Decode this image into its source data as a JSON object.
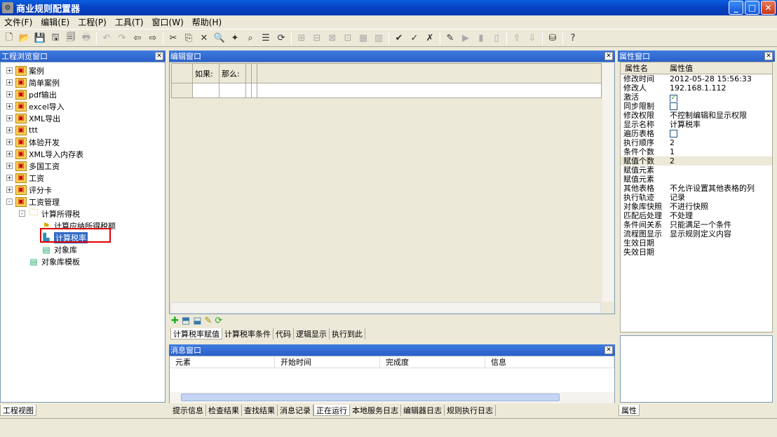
{
  "window": {
    "title": "商业规则配置器"
  },
  "menu": [
    "文件(F)",
    "编辑(E)",
    "工程(P)",
    "工具(T)",
    "窗口(W)",
    "帮助(H)"
  ],
  "toolbar_icons": [
    "new-file",
    "open-folder",
    "save",
    "disk",
    "save-all",
    "print",
    "undo",
    "redo",
    "back",
    "forward",
    "cut",
    "copy",
    "delete",
    "find",
    "wand",
    "binoculars",
    "properties",
    "refresh",
    "rule1",
    "rule2",
    "rule3",
    "rule4",
    "rule5",
    "rule6",
    "check1",
    "check2",
    "check3",
    "edit",
    "play",
    "chart1",
    "chart2",
    "export",
    "import",
    "db",
    "help"
  ],
  "project_panel": {
    "title": "工程浏览窗口",
    "items": [
      {
        "label": "案例",
        "level": 0,
        "toggle": "+",
        "icon": "proj"
      },
      {
        "label": "简单案例",
        "level": 0,
        "toggle": "+",
        "icon": "proj"
      },
      {
        "label": "pdf输出",
        "level": 0,
        "toggle": "+",
        "icon": "proj"
      },
      {
        "label": "excel导入",
        "level": 0,
        "toggle": "+",
        "icon": "proj"
      },
      {
        "label": "XML导出",
        "level": 0,
        "toggle": "+",
        "icon": "proj"
      },
      {
        "label": "ttt",
        "level": 0,
        "toggle": "+",
        "icon": "proj"
      },
      {
        "label": "体验开发",
        "level": 0,
        "toggle": "+",
        "icon": "proj"
      },
      {
        "label": "XML导入内存表",
        "level": 0,
        "toggle": "+",
        "icon": "proj"
      },
      {
        "label": "多国工资",
        "level": 0,
        "toggle": "+",
        "icon": "proj"
      },
      {
        "label": "工资",
        "level": 0,
        "toggle": "+",
        "icon": "proj"
      },
      {
        "label": "评分卡",
        "level": 0,
        "toggle": "+",
        "icon": "proj"
      },
      {
        "label": "工资管理",
        "level": 0,
        "toggle": "-",
        "icon": "proj"
      },
      {
        "label": "计算所得税",
        "level": 1,
        "toggle": "-",
        "icon": "folder"
      },
      {
        "label": "计算应纳所得税额",
        "level": 2,
        "toggle": "",
        "icon": "rule"
      },
      {
        "label": "计算税率",
        "level": 2,
        "toggle": "",
        "icon": "calc",
        "selected": true
      },
      {
        "label": "对象库",
        "level": 2,
        "toggle": "",
        "icon": "lib"
      },
      {
        "label": "对象库模板",
        "level": 1,
        "toggle": "",
        "icon": "lib"
      }
    ],
    "tab": "工程视图"
  },
  "editor": {
    "title": "编辑窗口",
    "headers": [
      "如果:",
      "那么:"
    ],
    "bottom_icons": [
      "add",
      "open",
      "export",
      "new",
      "refresh"
    ],
    "tabs": [
      "计算税率赋值",
      "计算税率条件",
      "代码",
      "逻辑显示",
      "执行到此"
    ]
  },
  "messages": {
    "title": "消息窗口",
    "columns": [
      "元素",
      "开始时间",
      "完成度",
      "信息"
    ],
    "tabs": [
      "提示信息",
      "检查结果",
      "查找结果",
      "消息记录",
      "正在运行",
      "本地服务日志",
      "编辑器日志",
      "规则执行日志"
    ]
  },
  "properties": {
    "title": "属性窗口",
    "col_name": "属性名",
    "col_value": "属性值",
    "rows": [
      {
        "name": "修改时间",
        "value": "2012-05-28 15:56:33"
      },
      {
        "name": "修改人",
        "value": "192.168.1.112"
      },
      {
        "name": "激活",
        "check": true
      },
      {
        "name": "同步限制",
        "check": false
      },
      {
        "name": "修改权限",
        "value": "不控制编辑和显示权限"
      },
      {
        "name": "显示名称",
        "value": "计算税率"
      },
      {
        "name": "遍历表格",
        "check": false
      },
      {
        "name": "执行顺序",
        "value": "2"
      },
      {
        "name": "条件个数",
        "value": "1"
      },
      {
        "name": "赋值个数",
        "value": "2",
        "selected": true
      },
      {
        "name": "赋值元素",
        "value": ""
      },
      {
        "name": "赋值元素",
        "value": ""
      },
      {
        "name": "其他表格",
        "value": "不允许设置其他表格的列"
      },
      {
        "name": "执行轨迹",
        "value": "记录"
      },
      {
        "name": "对象库快照",
        "value": "不进行快照"
      },
      {
        "name": "匹配后处理",
        "value": "不处理"
      },
      {
        "name": "条件间关系",
        "value": "只能满足一个条件"
      },
      {
        "name": "流程图显示",
        "value": "显示规则定义内容"
      },
      {
        "name": "生效日期",
        "value": ""
      },
      {
        "name": "失效日期",
        "value": ""
      }
    ],
    "tab": "属性"
  }
}
